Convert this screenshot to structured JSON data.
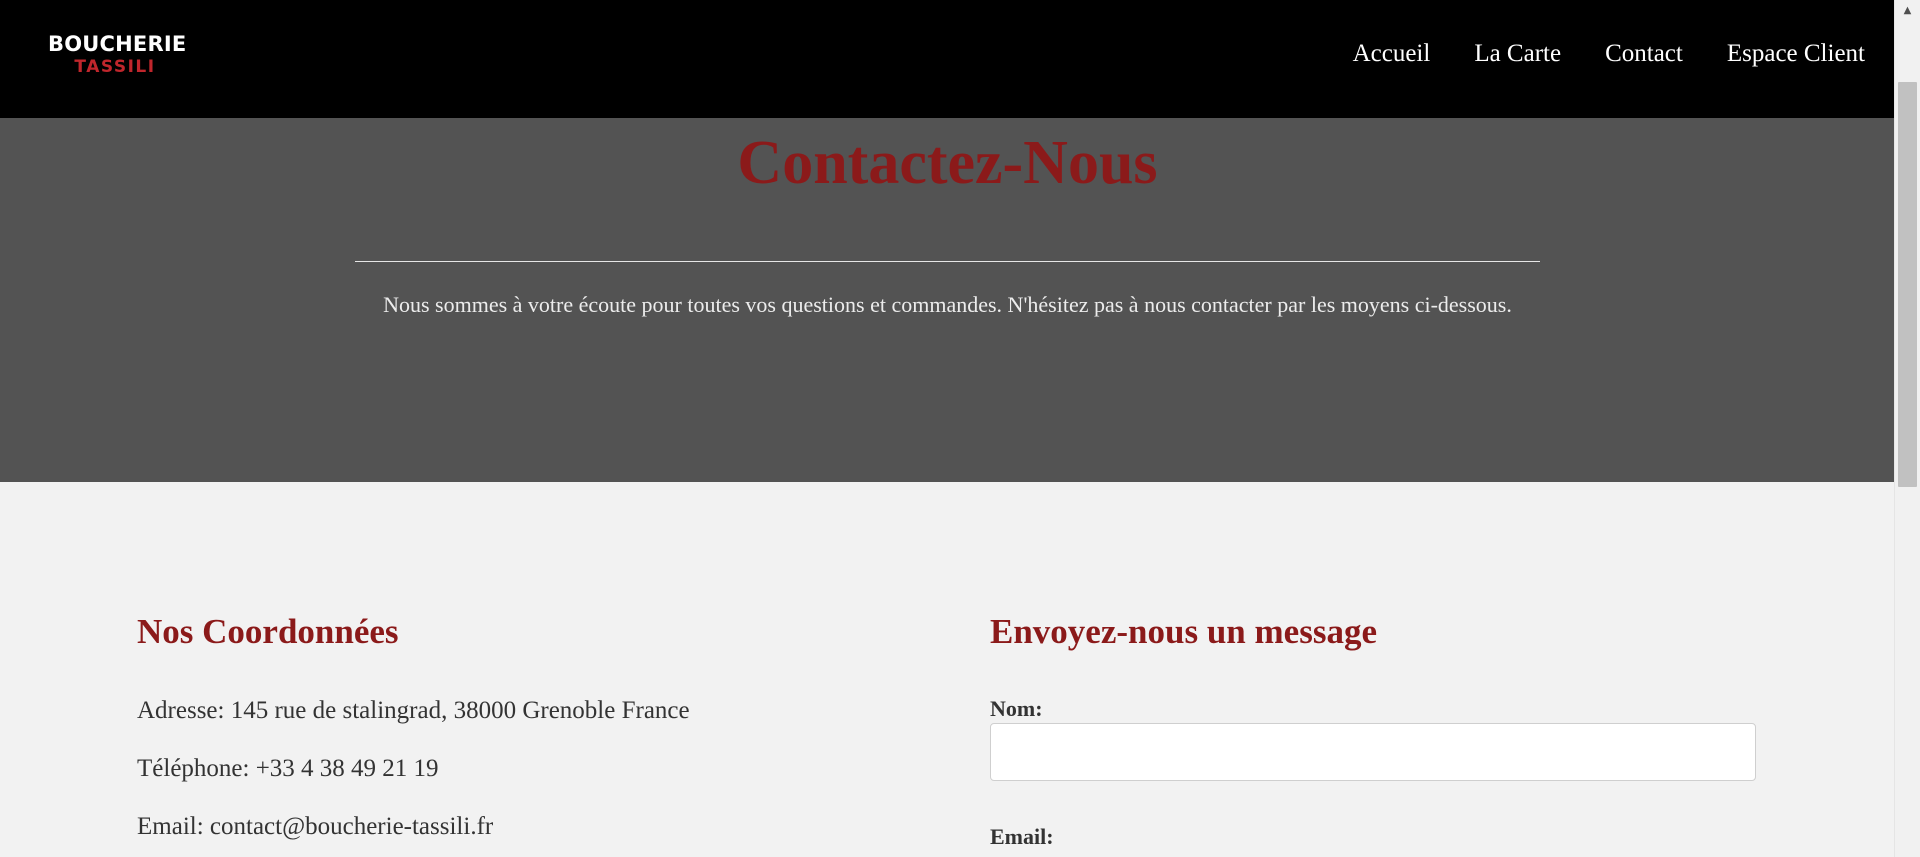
{
  "header": {
    "logo_line1": "BOUCHERIE",
    "logo_line2": "TASSILI",
    "nav": [
      {
        "label": "Accueil"
      },
      {
        "label": "La Carte"
      },
      {
        "label": "Contact"
      },
      {
        "label": "Espace Client"
      }
    ]
  },
  "hero": {
    "title": "Contactez-Nous",
    "text": "Nous sommes à votre écoute pour toutes vos questions et commandes. N'hésitez pas à nous contacter par les moyens ci-dessous."
  },
  "contact_info": {
    "title": "Nos Coordonnées",
    "address": "Adresse: 145 rue de stalingrad, 38000 Grenoble France",
    "phone": "Téléphone: +33 4 38 49 21 19",
    "email": "Email: contact@boucherie-tassili.fr"
  },
  "form": {
    "title": "Envoyez-nous un message",
    "name_label": "Nom:",
    "name_value": "",
    "email_label": "Email:"
  },
  "colors": {
    "accent": "#8b1a1a",
    "header_bg": "#000000",
    "hero_bg": "#535353",
    "content_bg": "#f2f2f2"
  },
  "scrollbar": {
    "arrow_icon": "scroll-up-arrow-icon"
  }
}
